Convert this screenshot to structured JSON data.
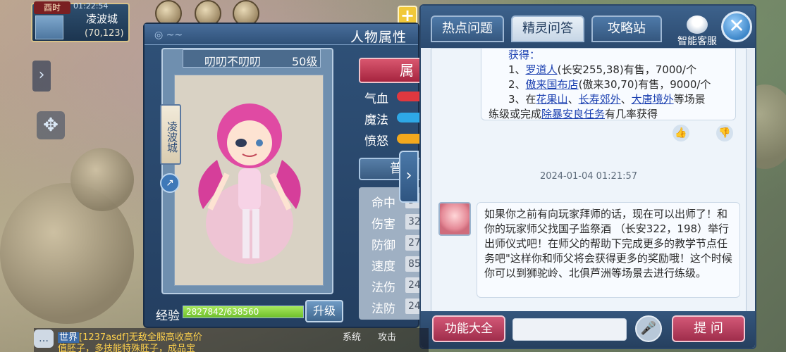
{
  "location": {
    "tag": "酉时",
    "time": "01:22:54",
    "city": "凌波城",
    "coords": "(70,123)"
  },
  "character_window": {
    "title": "人物属性",
    "name": "叨叨不叨叨",
    "level": "50级",
    "city_vertical": "凌波城",
    "attr_header": "属",
    "bars": [
      {
        "label": "气血",
        "color": "#e0383f"
      },
      {
        "label": "魔法",
        "color": "#2ea8e6"
      },
      {
        "label": "愤怒",
        "color": "#f2a81d"
      }
    ],
    "basic_header": "普",
    "stats": [
      {
        "label": "命中",
        "value": "3"
      },
      {
        "label": "伤害",
        "value": "32"
      },
      {
        "label": "防御",
        "value": "27"
      },
      {
        "label": "速度",
        "value": "85"
      },
      {
        "label": "法伤",
        "value": "24"
      },
      {
        "label": "法防",
        "value": "24"
      }
    ],
    "exp_label": "经验",
    "exp_text": "2827842/638560",
    "exp_progress": 1.0,
    "upgrade_label": "升级"
  },
  "help_window": {
    "tabs": [
      {
        "label": "热点问题",
        "active": false
      },
      {
        "label": "精灵问答",
        "active": true
      },
      {
        "label": "攻略站",
        "active": false
      }
    ],
    "agent_label": "智能客服",
    "close_icon": "close-icon",
    "answer_header": "获得：",
    "answer_line1_prefix": "1、",
    "answer_line1_link": "罗道人",
    "answer_line1_rest": "(长安255,38)有售，7000/个",
    "answer_line2_prefix": "2、",
    "answer_line2_link": "傲来国布店",
    "answer_line2_rest": "(傲来30,70)有售，9000/个",
    "answer_line3_prefix": "3、在",
    "answer_line3_link1": "花果山",
    "answer_line3_sep1": "、",
    "answer_line3_link2": "长寿郊外",
    "answer_line3_sep2": "、",
    "answer_line3_link3": "大唐境外",
    "answer_line3_rest": "等场景",
    "answer_line4_prefix": "练级或完成",
    "answer_line4_link": "除暴安良任务",
    "answer_line4_rest": "有几率获得",
    "timestamp": "2024-01-04 01:21:57",
    "message": "如果你之前有向玩家拜师的话，现在可以出师了！和你的玩家师父找国子监祭酒 （长安322，198）举行出师仪式吧！在师父的帮助下完成更多的教学节点任务吧\"这样你和师父将会获得更多的奖励哦！这个时候你可以到狮驼岭、北俱芦洲等场景去进行练级。",
    "func_button": "功能大全",
    "ask_placeholder": "",
    "ask_button": "提 问"
  },
  "world_chat": {
    "channel": "世界",
    "line1_user": "[1237asdf]",
    "line1_text": "无敌全服高收高价",
    "line2_text": "值胚子，多技能特殊胚子，成品宝",
    "tab_system": "系统",
    "tab_attack": "攻击"
  }
}
